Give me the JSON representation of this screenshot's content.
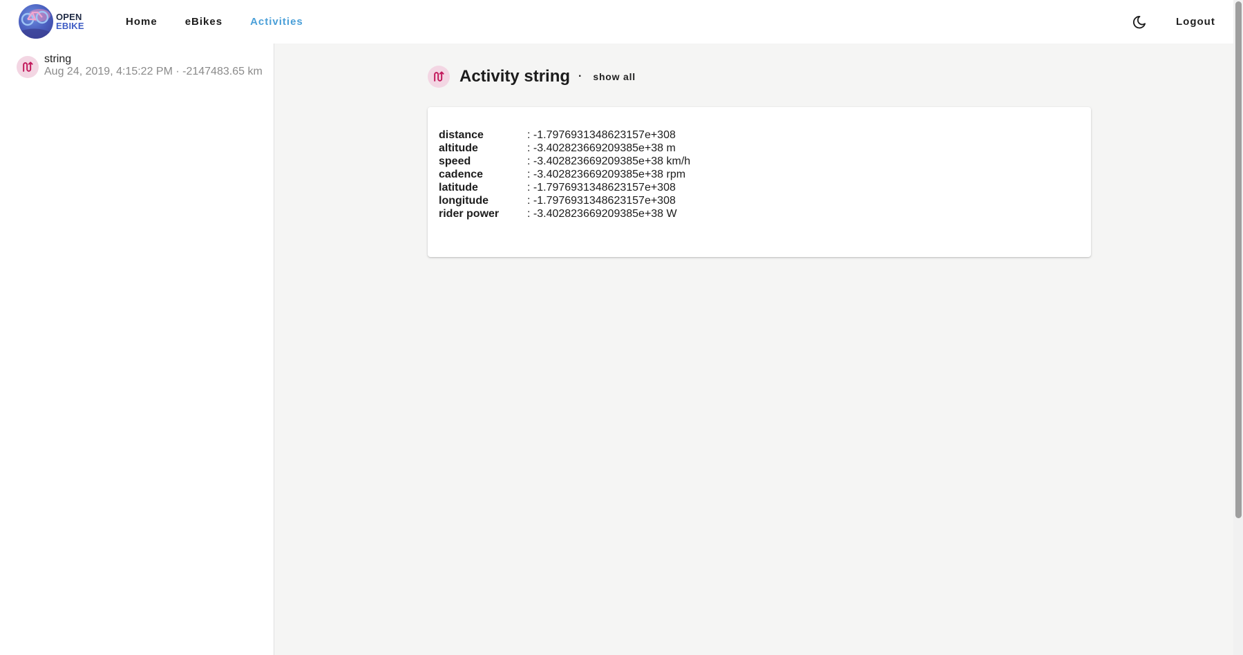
{
  "app": {
    "logo_line1": "OPEN",
    "logo_line2": "EBIKE"
  },
  "nav": {
    "items": [
      {
        "label": "Home",
        "active": false
      },
      {
        "label": "eBikes",
        "active": false
      },
      {
        "label": "Activities",
        "active": true
      }
    ],
    "theme_icon": "moon-icon",
    "logout_label": "Logout"
  },
  "sidebar": {
    "activities": [
      {
        "title": "string",
        "subtitle": "Aug 24, 2019, 4:15:22 PM · -2147483.65 km",
        "icon": "route-icon"
      }
    ]
  },
  "main": {
    "title": "Activity string",
    "separator": "·",
    "show_all_label": "show all",
    "properties": [
      {
        "key": "distance",
        "value": ": -1.7976931348623157e+308"
      },
      {
        "key": "altitude",
        "value": ": -3.402823669209385e+38 m"
      },
      {
        "key": "speed",
        "value": ": -3.402823669209385e+38 km/h"
      },
      {
        "key": "cadence",
        "value": ": -3.402823669209385e+38 rpm"
      },
      {
        "key": "latitude",
        "value": ": -1.7976931348623157e+308"
      },
      {
        "key": "longitude",
        "value": ": -1.7976931348623157e+308"
      },
      {
        "key": "rider power",
        "value": ": -3.402823669209385e+38 W"
      }
    ]
  },
  "colors": {
    "accent": "#4a9fd8",
    "avatar_bg": "#f3d6e3",
    "route_icon": "#c2185b",
    "main_bg": "#f5f5f4"
  }
}
